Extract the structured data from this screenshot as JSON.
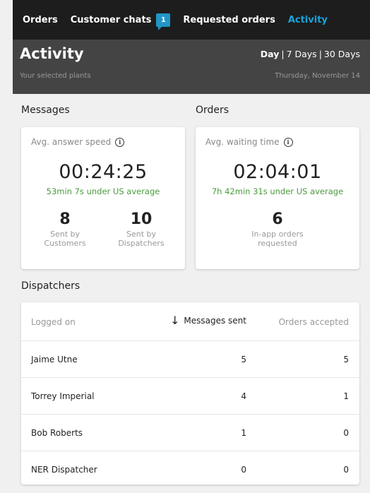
{
  "nav": {
    "tabs": [
      {
        "label": "Orders"
      },
      {
        "label": "Customer chats",
        "badge": "1"
      },
      {
        "label": "Requested orders"
      },
      {
        "label": "Activity",
        "active": true
      }
    ]
  },
  "header": {
    "title": "Activity",
    "subtitle": "Your selected plants",
    "range": {
      "day": "Day",
      "seven": "7 Days",
      "thirty": "30 Days",
      "separator": "|"
    },
    "date": "Thursday, November 14"
  },
  "messages": {
    "section": "Messages",
    "label": "Avg. answer speed",
    "value": "00:24:25",
    "comparison": "53min 7s under US average",
    "stats": [
      {
        "value": "8",
        "label_line1": "Sent by",
        "label_line2": "Customers"
      },
      {
        "value": "10",
        "label_line1": "Sent by",
        "label_line2": "Dispatchers"
      }
    ]
  },
  "orders": {
    "section": "Orders",
    "label": "Avg. waiting time",
    "value": "02:04:01",
    "comparison": "7h 42min 31s under US average",
    "stats": [
      {
        "value": "6",
        "label_line1": "In-app orders",
        "label_line2": "requested"
      }
    ]
  },
  "dispatchers": {
    "section": "Dispatchers",
    "columns": [
      "Logged on",
      "Messages sent",
      "Orders accepted"
    ],
    "rows": [
      {
        "name": "Jaime Utne",
        "messages": "5",
        "orders": "5"
      },
      {
        "name": "Torrey Imperial",
        "messages": "4",
        "orders": "1"
      },
      {
        "name": "Bob Roberts",
        "messages": "1",
        "orders": "0"
      },
      {
        "name": "NER Dispatcher",
        "messages": "0",
        "orders": "0"
      }
    ]
  },
  "icons": {
    "info": "info-icon",
    "sort": "arrow-down-icon"
  },
  "colors": {
    "nav_bg": "#1d1d1d",
    "header_bg": "#444444",
    "accent": "#1aa3d9",
    "badge": "#2196c7",
    "positive": "#4a9a3c"
  }
}
